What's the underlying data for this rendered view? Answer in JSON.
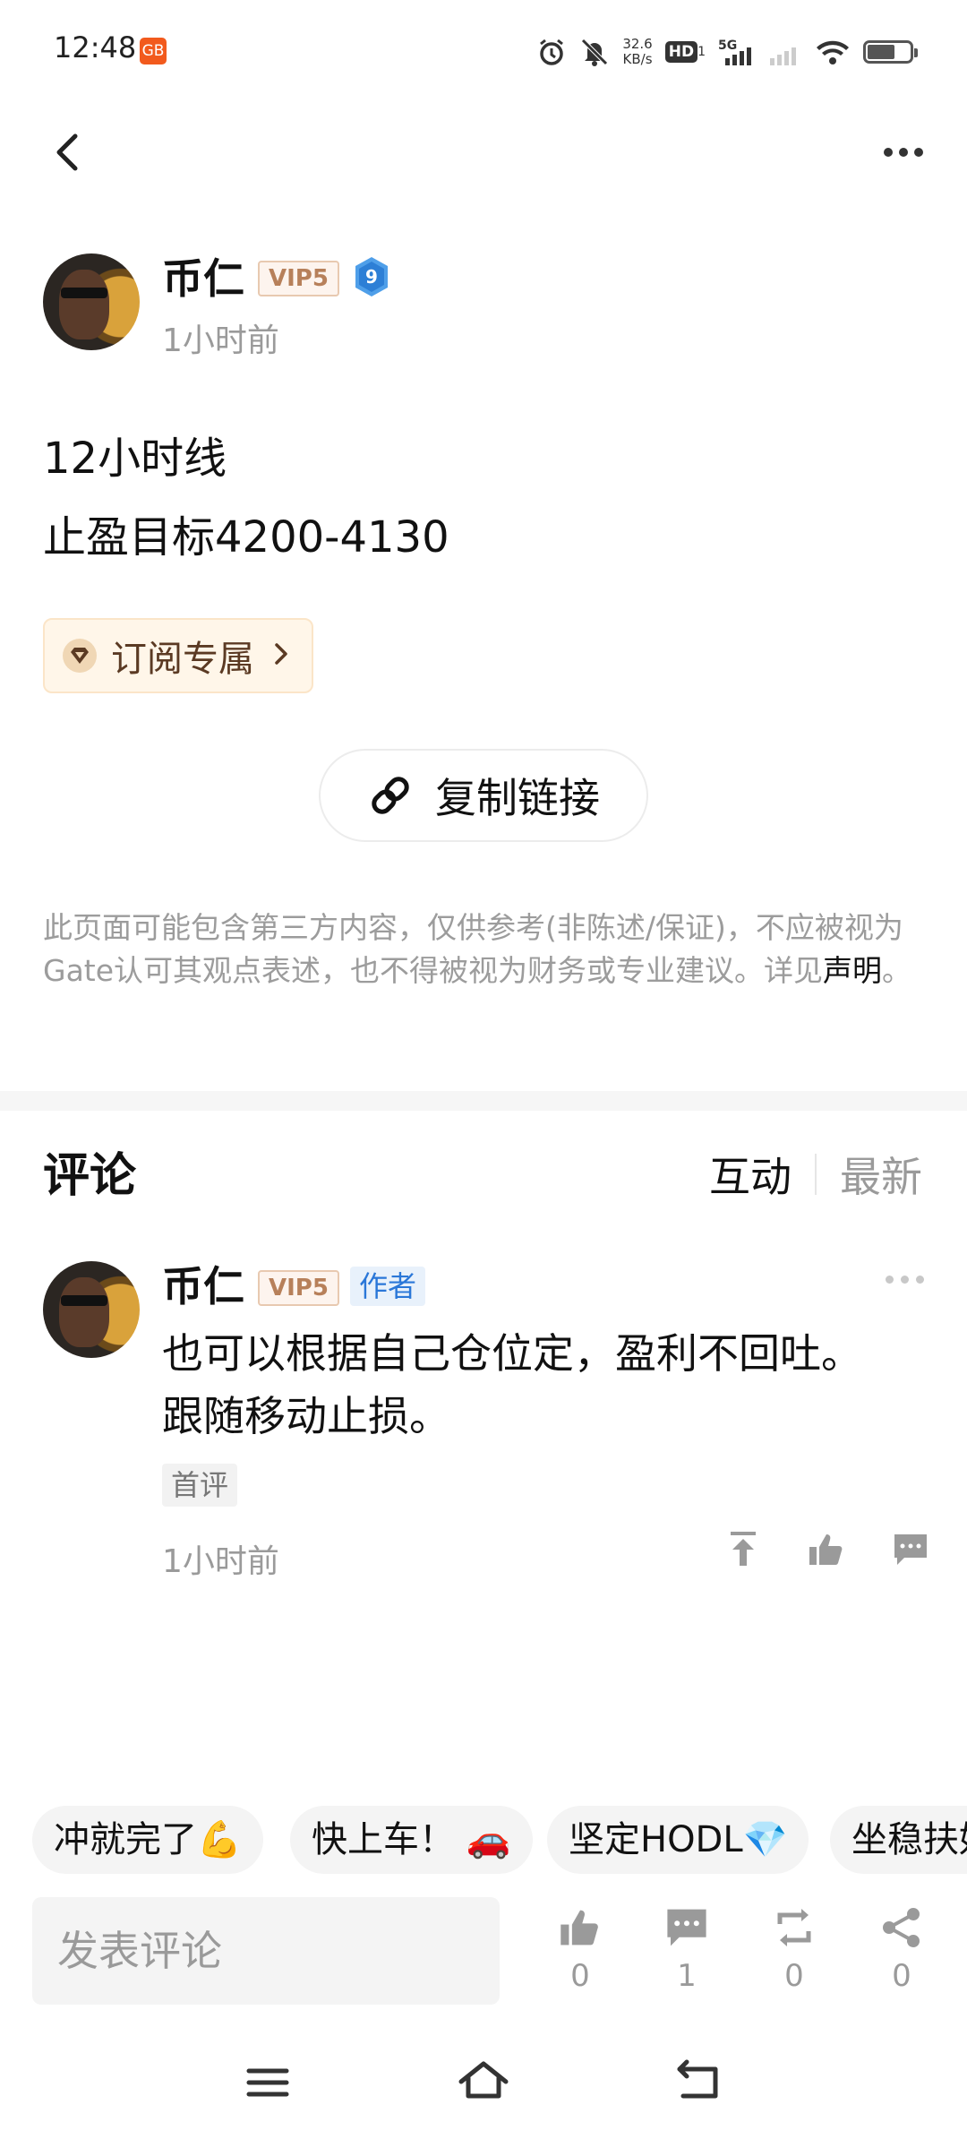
{
  "status_bar": {
    "time": "12:48",
    "app_badge": "GB",
    "net_speed_value": "32.6",
    "net_speed_unit": "KB/s",
    "hd_label": "HD",
    "hd_sub": "1",
    "network_type": "5G"
  },
  "post": {
    "author_name": "币仁",
    "vip_label": "VIP5",
    "level": "9",
    "time": "1小时前",
    "lines": [
      "12小时线",
      "止盈目标4200-4130"
    ],
    "subscribe_label": "订阅专属",
    "copy_link_label": "复制链接",
    "disclaimer_text": "此页面可能包含第三方内容，仅供参考(非陈述/保证)，不应被视为Gate认可其观点表述，也不得被视为财务或专业建议。详见",
    "disclaimer_link": "声明",
    "disclaimer_end": "。"
  },
  "comments_section": {
    "title": "评论",
    "sort_active": "互动",
    "sort_inactive": "最新",
    "items": [
      {
        "author_name": "币仁",
        "vip_label": "VIP5",
        "author_tag": "作者",
        "text_lines": [
          "也可以根据自己仓位定，盈利不回吐。",
          "跟随移动止损。"
        ],
        "first_tag": "首评",
        "time": "1小时前"
      }
    ]
  },
  "quick_replies": [
    "冲就完了💪",
    "快上车！ 🚗",
    "坚定HODL💎",
    "坐稳扶好"
  ],
  "bottom_bar": {
    "input_placeholder": "发表评论",
    "like_count": "0",
    "comment_count": "1",
    "repost_count": "0",
    "share_count": "0"
  },
  "colors": {
    "accent_blue": "#2a77d8",
    "vip_text": "#b7805a",
    "subscribe_bg": "#fff6e9",
    "muted": "#9a9a9a"
  }
}
